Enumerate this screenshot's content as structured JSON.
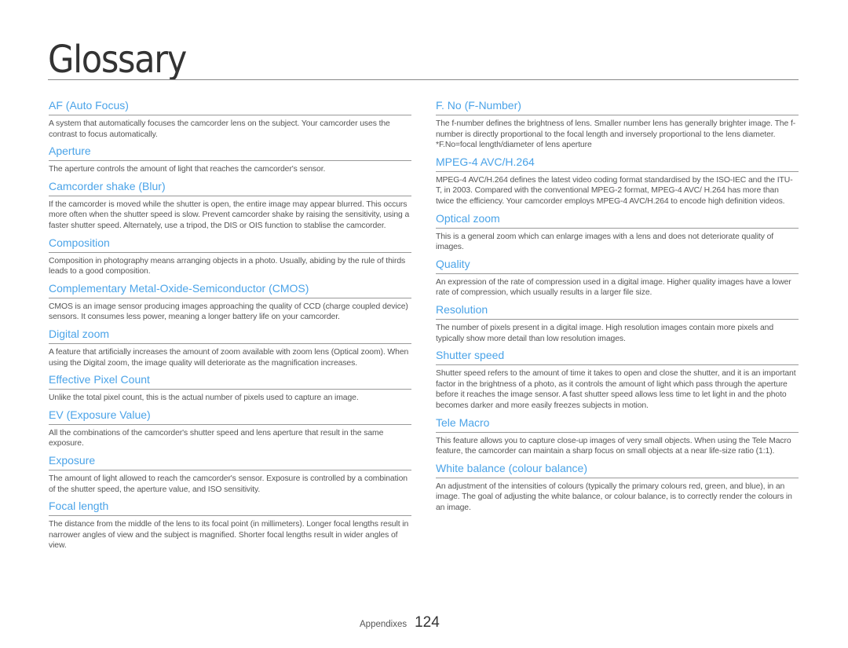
{
  "page": {
    "title": "Glossary",
    "footer_section": "Appendixes",
    "page_number": "124",
    "colors": {
      "heading": "#4aa3e8",
      "body": "#555555",
      "rule": "#999999"
    }
  },
  "left_column": [
    {
      "term": "AF (Auto Focus)",
      "definition": [
        "A system that automatically focuses the camcorder lens on the subject. Your camcorder uses the contrast to focus automatically."
      ]
    },
    {
      "term": "Aperture",
      "definition": [
        "The aperture controls the amount of light that reaches the camcorder's sensor."
      ]
    },
    {
      "term": "Camcorder shake (Blur)",
      "definition": [
        "If the camcorder is moved while the shutter is open, the entire image may appear blurred. This occurs more often when the shutter speed is slow. Prevent camcorder shake by raising the sensitivity, using a faster shutter speed. Alternately, use a tripod, the DIS or OIS function to stablise the camcorder."
      ]
    },
    {
      "term": "Composition",
      "definition": [
        "Composition in photography means arranging objects in a photo. Usually, abiding by the rule of thirds leads to a good composition."
      ]
    },
    {
      "term": "Complementary Metal-Oxide-Semiconductor (CMOS)",
      "definition": [
        "CMOS is an image sensor producing images approaching the quality of CCD (charge coupled device) sensors. It consumes less power, meaning a longer battery life on your camcorder."
      ]
    },
    {
      "term": "Digital zoom",
      "definition": [
        "A feature that artificially increases the amount of zoom available with zoom lens (Optical zoom). When using the Digital zoom, the image quality will deteriorate as the magnification increases."
      ]
    },
    {
      "term": "Effective Pixel Count",
      "definition": [
        "Unlike the total pixel count, this is the actual number of pixels used to capture an image."
      ]
    },
    {
      "term": "EV (Exposure Value)",
      "definition": [
        "All the combinations of the camcorder's shutter speed and lens aperture that result in the same exposure."
      ]
    },
    {
      "term": "Exposure",
      "definition": [
        "The amount of light allowed to reach the camcorder's sensor. Exposure is controlled by a combination of the shutter speed, the aperture value, and ISO sensitivity."
      ]
    },
    {
      "term": "Focal length",
      "definition": [
        "The distance from the middle of the lens to its focal point (in millimeters). Longer focal lengths result in narrower angles of view and the subject is magnified. Shorter focal lengths result in wider angles of view."
      ]
    }
  ],
  "right_column": [
    {
      "term": "F. No (F-Number)",
      "definition": [
        "The f-number defines the brightness of lens. Smaller number lens has generally brighter image. The f-number is directly proportional to the focal length and inversely proportional to the lens diameter.",
        "*F.No=focal length/diameter of lens aperture"
      ]
    },
    {
      "term": "MPEG-4 AVC/H.264",
      "definition": [
        "MPEG-4 AVC/H.264 defines the latest video coding format standardised by the ISO-IEC and the ITU-T, in 2003. Compared with the conventional MPEG-2 format, MPEG-4 AVC/ H.264 has more than twice the efficiency. Your camcorder employs MPEG-4 AVC/H.264 to encode high definition videos."
      ]
    },
    {
      "term": "Optical zoom",
      "definition": [
        "This is a general zoom which can enlarge images with a lens and does not deteriorate quality of images."
      ]
    },
    {
      "term": "Quality",
      "definition": [
        "An expression of the rate of compression used in a digital image. Higher quality images have a lower rate of compression, which usually results in a larger file size."
      ]
    },
    {
      "term": "Resolution",
      "definition": [
        "The number of pixels present in a digital image. High resolution images contain more pixels and typically show more detail than low resolution images."
      ]
    },
    {
      "term": "Shutter speed",
      "definition": [
        "Shutter speed refers to the amount of time it takes to open and close the shutter, and it is an important factor in the brightness of a photo, as it controls the amount of light which pass through the aperture before it reaches the image sensor. A fast shutter speed allows less time to let light in and the photo becomes darker and more easily freezes subjects in motion."
      ]
    },
    {
      "term": "Tele Macro",
      "definition": [
        "This feature allows you to capture close-up images of very small objects. When using the Tele Macro feature, the camcorder can maintain a sharp focus on small objects at a near life-size ratio (1:1)."
      ]
    },
    {
      "term": "White balance (colour balance)",
      "definition": [
        "An adjustment of the intensities of colours (typically the primary colours red, green, and blue), in an image. The goal of adjusting the white balance, or colour balance, is to correctly render the colours in an image."
      ]
    }
  ]
}
